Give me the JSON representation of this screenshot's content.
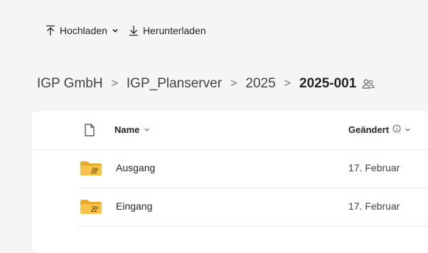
{
  "toolbar": {
    "upload_label": "Hochladen",
    "download_label": "Herunterladen",
    "upload_icon": "upload-arrow-icon",
    "download_icon": "download-arrow-icon"
  },
  "breadcrumb": {
    "items": [
      "IGP GmbH",
      "IGP_Planserver",
      "2025"
    ],
    "current": "2025-001",
    "separator": ">"
  },
  "list": {
    "columns": {
      "name": "Name",
      "modified": "Geändert"
    },
    "rows": [
      {
        "name": "Ausgang",
        "modified": "17. Februar",
        "type": "shared-folder"
      },
      {
        "name": "Eingang",
        "modified": "17. Februar",
        "type": "shared-folder"
      }
    ]
  },
  "colors": {
    "background": "#f5f5f5",
    "card": "#ffffff",
    "folder": "#f7c34a",
    "folder_dark": "#e8a92c",
    "text": "#242424"
  }
}
